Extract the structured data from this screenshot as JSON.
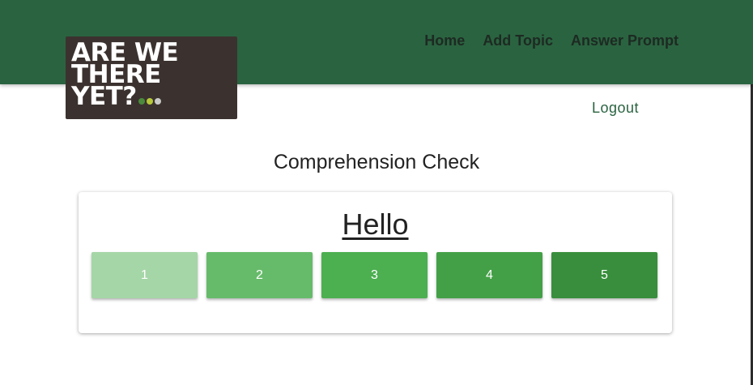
{
  "logo": {
    "lines": [
      "ARE WE",
      "THERE",
      "YET?"
    ],
    "dot_colors": [
      "#4c8a3c",
      "#b7c93a",
      "#c9c9c9"
    ]
  },
  "nav": {
    "home": "Home",
    "add_topic": "Add Topic",
    "answer_prompt": "Answer Prompt"
  },
  "logout": "Logout",
  "page_title": "Comprehension Check",
  "prompt": "Hello",
  "ratings": [
    {
      "label": "1",
      "color": "#a5d6a7"
    },
    {
      "label": "2",
      "color": "#66bb6a"
    },
    {
      "label": "3",
      "color": "#4caf50"
    },
    {
      "label": "4",
      "color": "#43a047"
    },
    {
      "label": "5",
      "color": "#388e3c"
    }
  ],
  "colors": {
    "header": "#2a6340",
    "logo_bg": "#3b322f"
  }
}
